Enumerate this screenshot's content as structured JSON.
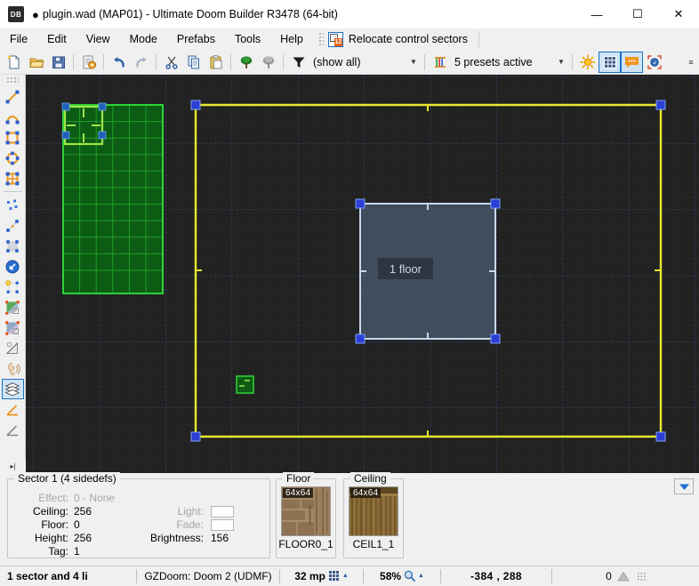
{
  "window": {
    "app_icon_text": "DB",
    "modified_marker": "●",
    "title": "plugin.wad (MAP01) - Ultimate Doom Builder R3478 (64-bit)",
    "controls": {
      "minimize": "—",
      "maximize": "☐",
      "close": "✕"
    }
  },
  "menubar": {
    "items": [
      {
        "label": "File"
      },
      {
        "label": "Edit"
      },
      {
        "label": "View"
      },
      {
        "label": "Mode"
      },
      {
        "label": "Prefabs"
      },
      {
        "label": "Tools"
      },
      {
        "label": "Help"
      }
    ],
    "plugin_button": {
      "label": "Relocate control sectors",
      "icon": "relocate-control-sectors-icon",
      "badge": "12"
    }
  },
  "toolbar": {
    "buttons": [
      {
        "name": "new-map-button",
        "icon": "new-file-icon",
        "tooltip": "New map"
      },
      {
        "name": "open-map-button",
        "icon": "open-folder-icon",
        "tooltip": "Open map"
      },
      {
        "name": "save-map-button",
        "icon": "save-disk-icon",
        "tooltip": "Save map"
      },
      {
        "name": "test-map-button",
        "icon": "script-gear-icon",
        "tooltip": "Map options"
      },
      {
        "name": "undo-button",
        "icon": "undo-arrow-icon",
        "tooltip": "Undo"
      },
      {
        "name": "redo-button",
        "icon": "redo-arrow-icon",
        "tooltip": "Redo"
      },
      {
        "name": "cut-button",
        "icon": "scissors-icon",
        "tooltip": "Cut"
      },
      {
        "name": "copy-button",
        "icon": "copy-pages-icon",
        "tooltip": "Copy"
      },
      {
        "name": "paste-button",
        "icon": "clipboard-icon",
        "tooltip": "Paste"
      },
      {
        "name": "show-things-button",
        "icon": "green-tree-icon",
        "tooltip": "Show things"
      },
      {
        "name": "hide-things-button",
        "icon": "gray-tree-icon",
        "tooltip": "Hide things"
      }
    ],
    "thing_filter": {
      "value": "(show all)",
      "icon": "funnel-filter-icon",
      "arrow": "▼"
    },
    "presets": {
      "value": "5 presets active",
      "icon": "texture-presets-icon",
      "arrow": "▼"
    },
    "right_buttons": [
      {
        "name": "dynamic-light-button",
        "icon": "sun-icon",
        "active": false
      },
      {
        "name": "grid-toggle-button",
        "icon": "grid-icon",
        "active": true
      },
      {
        "name": "comments-button",
        "icon": "comment-bubble-icon",
        "active": true
      },
      {
        "name": "fit-to-screen-button",
        "icon": "fit-screen-icon",
        "active": false
      }
    ],
    "overflow_arrow": "≡"
  },
  "left_toolbar": {
    "items": [
      {
        "name": "draw-lines-tool",
        "icon": "draw-line-icon",
        "active": false
      },
      {
        "name": "draw-curve-tool",
        "icon": "draw-curve-icon",
        "active": false
      },
      {
        "name": "draw-rectangle-tool",
        "icon": "draw-rectangle-icon",
        "active": false
      },
      {
        "name": "draw-ellipse-tool",
        "icon": "draw-ellipse-icon",
        "active": false
      },
      {
        "name": "draw-grid-tool",
        "icon": "draw-grid-icon",
        "active": false
      },
      {
        "name": "vertices-mode",
        "icon": "vertices-icon",
        "active": false
      },
      {
        "name": "linedefs-mode",
        "icon": "linedefs-icon",
        "active": false
      },
      {
        "name": "sectors-mode",
        "icon": "sectors-icon",
        "active": false
      },
      {
        "name": "things-mode",
        "icon": "things-cursor-icon",
        "active": false
      },
      {
        "name": "edit-selection-mode",
        "icon": "edit-selection-icon",
        "active": false
      },
      {
        "name": "floor-align-mode",
        "icon": "floor-align-icon",
        "active": false
      },
      {
        "name": "ceiling-align-mode",
        "icon": "ceiling-align-icon",
        "active": false
      },
      {
        "name": "brightness-mode",
        "icon": "brightness-icon",
        "active": false
      },
      {
        "name": "sound-propagation-mode",
        "icon": "sound-ear-icon",
        "active": false
      },
      {
        "name": "sector-3d-floors-mode",
        "icon": "stacked-layers-icon",
        "active": true
      },
      {
        "name": "slope-mode",
        "icon": "slope-orange-icon",
        "active": false
      },
      {
        "name": "slope-gray-mode",
        "icon": "slope-gray-icon",
        "active": false
      }
    ],
    "expand_arrow": "▸|"
  },
  "canvas": {
    "background_color": "#222222",
    "grid_minor_color": "#3a3a3a",
    "grid_major_color": "#2b4f86",
    "selected_sector_label": "1 floor",
    "colors": {
      "yellow_line": "#e8e82e",
      "green_sector_fill": "#0d5c14",
      "green_sector_line": "#2fd438",
      "green_highlight_line": "#9ee64a",
      "selected_fill": "#4d5d73",
      "selected_line": "#c5d8ef",
      "vertex": "#2b3fd6"
    }
  },
  "info_panel": {
    "sector": {
      "title": "Sector 1 (4 sidedefs)",
      "rows": [
        {
          "label": "Effect:",
          "value": "0 - None",
          "dim": true
        },
        {
          "label": "Ceiling:",
          "value": "256",
          "dim": false
        },
        {
          "label": "Floor:",
          "value": "0",
          "dim": false
        },
        {
          "label": "Height:",
          "value": "256",
          "dim": false
        },
        {
          "label": "Tag:",
          "value": "1",
          "dim": false
        }
      ],
      "right_rows": [
        {
          "label": "Light:",
          "value": "",
          "dim": true,
          "swatch": true
        },
        {
          "label": "Fade:",
          "value": "",
          "dim": true,
          "swatch": true
        },
        {
          "label": "Brightness:",
          "value": "156",
          "dim": false,
          "swatch": false
        }
      ]
    },
    "floor": {
      "group": "Floor",
      "size_badge": "64x64",
      "texture_name": "FLOOR0_1"
    },
    "ceiling": {
      "group": "Ceiling",
      "size_badge": "64x64",
      "texture_name": "CEIL1_1"
    },
    "collapse_arrow": "▼"
  },
  "status_bar": {
    "selection": "1 sector and 4 li",
    "game_config": "GZDoom: Doom 2 (UDMF)",
    "grid_size": "32 mp",
    "zoom": "58%",
    "coordinates": "-384 , 288",
    "last_value": "0",
    "zoom_icon": "magnifier-icon",
    "grid_icon": "grid-size-icon",
    "up_arrow": "▲"
  }
}
